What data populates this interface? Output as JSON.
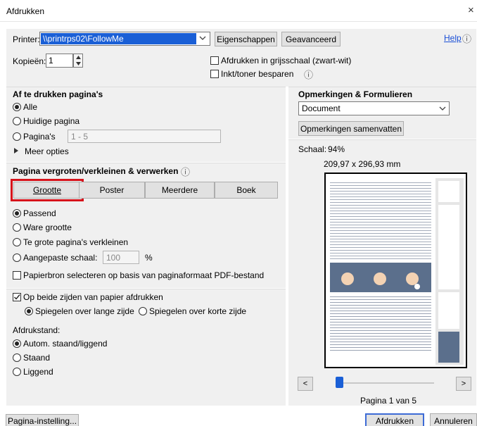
{
  "window": {
    "title": "Afdrukken",
    "close_glyph": "×"
  },
  "printer": {
    "label": "Printer:",
    "value": "\\\\printrps02\\FollowMe",
    "props_label": "Eigenschappen",
    "advanced_label": "Geavanceerd",
    "help_label": "Help",
    "help_icon": "ⓘ"
  },
  "copies": {
    "label": "Kopieën:",
    "value": "1"
  },
  "options": {
    "grayscale_label": "Afdrukken in grijsschaal (zwart-wit)",
    "save_ink_label": "Inkt/toner besparen",
    "info_icon": "ⓘ"
  },
  "pages": {
    "heading": "Af te drukken pagina's",
    "all_label": "Alle",
    "current_label": "Huidige pagina",
    "pages_label": "Pagina's",
    "pages_value": "1 - 5",
    "more_label": "Meer opties"
  },
  "sizing": {
    "heading": "Pagina vergroten/verkleinen & verwerken",
    "tabs": [
      "Grootte",
      "Poster",
      "Meerdere",
      "Boek"
    ],
    "fit_label": "Passend",
    "actual_label": "Ware grootte",
    "shrink_label": "Te grote pagina's verkleinen",
    "custom_label": "Aangepaste schaal:",
    "custom_value": "100",
    "percent": "%",
    "source_label": "Papierbron selecteren op basis van paginaformaat PDF-bestand"
  },
  "duplex": {
    "label": "Op beide zijden van papier afdrukken",
    "long_label": "Spiegelen over lange zijde",
    "short_label": "Spiegelen over korte zijde"
  },
  "orientation": {
    "heading": "Afdrukstand:",
    "auto_label": "Autom. staand/liggend",
    "portrait_label": "Staand",
    "landscape_label": "Liggend"
  },
  "comments": {
    "heading": "Opmerkingen & Formulieren",
    "select_value": "Document",
    "summarize_label": "Opmerkingen samenvatten"
  },
  "preview": {
    "scale_label": "Schaal:",
    "scale_value": "94%",
    "size_text": "209,97 x 296,93 mm",
    "page_text": "Pagina 1 van 5",
    "prev": "<",
    "next": ">"
  },
  "footer": {
    "page_setup_label": "Pagina-instelling...",
    "print_label": "Afdrukken",
    "cancel_label": "Annuleren"
  },
  "colors": {
    "accent": "#3d6bd6",
    "highlight": "#d7131b",
    "printer_bg": "#1a5fd6"
  }
}
